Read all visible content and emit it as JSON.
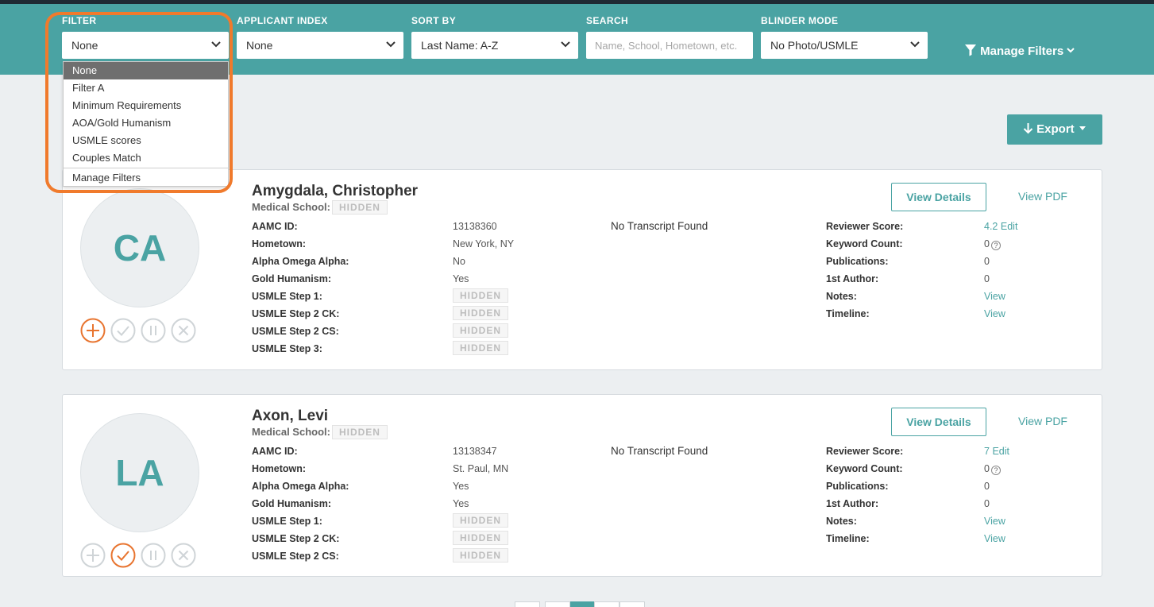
{
  "filters": {
    "filter": {
      "label": "FILTER",
      "value": "None"
    },
    "applicant_index": {
      "label": "APPLICANT INDEX",
      "value": "None"
    },
    "sort_by": {
      "label": "SORT BY",
      "value": "Last Name: A-Z"
    },
    "search": {
      "label": "SEARCH",
      "placeholder": "Name, School, Hometown, etc."
    },
    "blinder_mode": {
      "label": "BLINDER MODE",
      "value": "No Photo/USMLE"
    },
    "manage_filters": "Manage Filters"
  },
  "filter_dropdown": {
    "options": [
      "None",
      "Filter A",
      "Minimum Requirements",
      "AOA/Gold Humanism",
      "USMLE scores",
      "Couples Match"
    ],
    "selected": "None",
    "footer": "Manage Filters"
  },
  "export_label": "Export",
  "common": {
    "medical_school": "Medical School:",
    "hidden": "HIDDEN",
    "view_details": "View Details",
    "view_pdf": "View PDF",
    "no_transcript": "No Transcript Found",
    "edit": "Edit",
    "view": "View",
    "labels": {
      "aamc_id": "AAMC ID:",
      "hometown": "Hometown:",
      "aoa": "Alpha Omega Alpha:",
      "gold": "Gold Humanism:",
      "step1": "USMLE Step 1:",
      "step2ck": "USMLE Step 2 CK:",
      "step2cs": "USMLE Step 2 CS:",
      "step3": "USMLE Step 3:",
      "reviewer_score": "Reviewer Score:",
      "keyword_count": "Keyword Count:",
      "publications": "Publications:",
      "first_author": "1st Author:",
      "notes": "Notes:",
      "timeline": "Timeline:"
    }
  },
  "applicants": [
    {
      "name": "Amygdala, Christopher",
      "initials": "CA",
      "aamc_id": "13138360",
      "hometown": "New York, NY",
      "aoa": "No",
      "gold": "Yes",
      "reviewer_score": "4.2",
      "keyword_count": "0",
      "publications": "0",
      "first_author": "0",
      "status": "add"
    },
    {
      "name": "Axon, Levi",
      "initials": "LA",
      "aamc_id": "13138347",
      "hometown": "St. Paul, MN",
      "aoa": "Yes",
      "gold": "Yes",
      "reviewer_score": "7",
      "keyword_count": "0",
      "publications": "0",
      "first_author": "0",
      "status": "approve"
    }
  ],
  "colors": {
    "teal": "#4aa3a3",
    "highlight": "#f07a2c",
    "status_active": "#e8742f"
  }
}
